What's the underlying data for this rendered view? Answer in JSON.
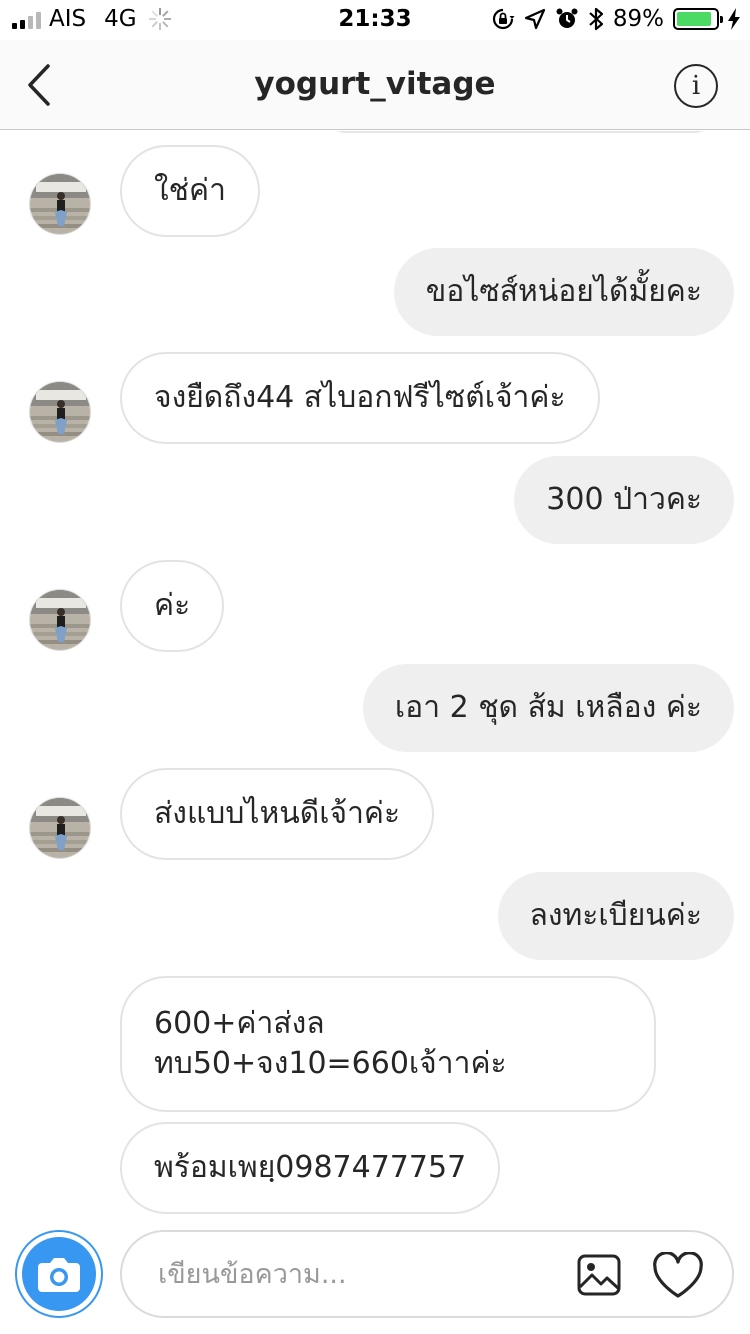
{
  "status_bar": {
    "carrier": "AIS",
    "network": "4G",
    "time": "21:33",
    "battery": "89%",
    "battery_level": 0.89,
    "signal_bars": 2,
    "icons": [
      "loading-icon",
      "rotation-lock-icon",
      "location-icon",
      "alarm-icon",
      "bluetooth-icon",
      "battery-icon",
      "charging-icon"
    ]
  },
  "header": {
    "title": "yogurt_vitage",
    "back_icon": "chevron-left-icon",
    "info_icon": "info-icon"
  },
  "messages": [
    {
      "dir": "in",
      "text": "ใช่ค่า",
      "avatar": true
    },
    {
      "dir": "out",
      "text": "ขอไซส์หน่อยได้มั้ยคะ"
    },
    {
      "dir": "in",
      "text": "จงยืดถึง44 สไบอกฟรีไซต์เจ้าค่ะ",
      "avatar": true
    },
    {
      "dir": "out",
      "text": "300 ป่าวคะ"
    },
    {
      "dir": "in",
      "text": "ค่ะ",
      "avatar": true
    },
    {
      "dir": "out",
      "text": "เอา 2 ชุด ส้ม เหลือง ค่ะ"
    },
    {
      "dir": "in",
      "text": "ส่งแบบไหนดีเจ้าค่ะ",
      "avatar": true
    },
    {
      "dir": "out",
      "text": "ลงทะเบียนค่ะ"
    },
    {
      "dir": "in",
      "text": "600+ค่าส่งลทบ50+จง10=660เจ้าาค่ะ",
      "avatar": false
    },
    {
      "dir": "in",
      "text": "พร้อมเพยฺ0987477757",
      "avatar": false
    }
  ],
  "composer": {
    "placeholder": "เขียนข้อความ...",
    "value": "",
    "camera_icon": "camera-icon",
    "gallery_icon": "image-icon",
    "like_icon": "heart-icon"
  },
  "colors": {
    "accent": "#3897f0",
    "outgoing_bubble": "#efefef",
    "incoming_border": "#e3e3e3",
    "battery_fill": "#4cd964"
  }
}
